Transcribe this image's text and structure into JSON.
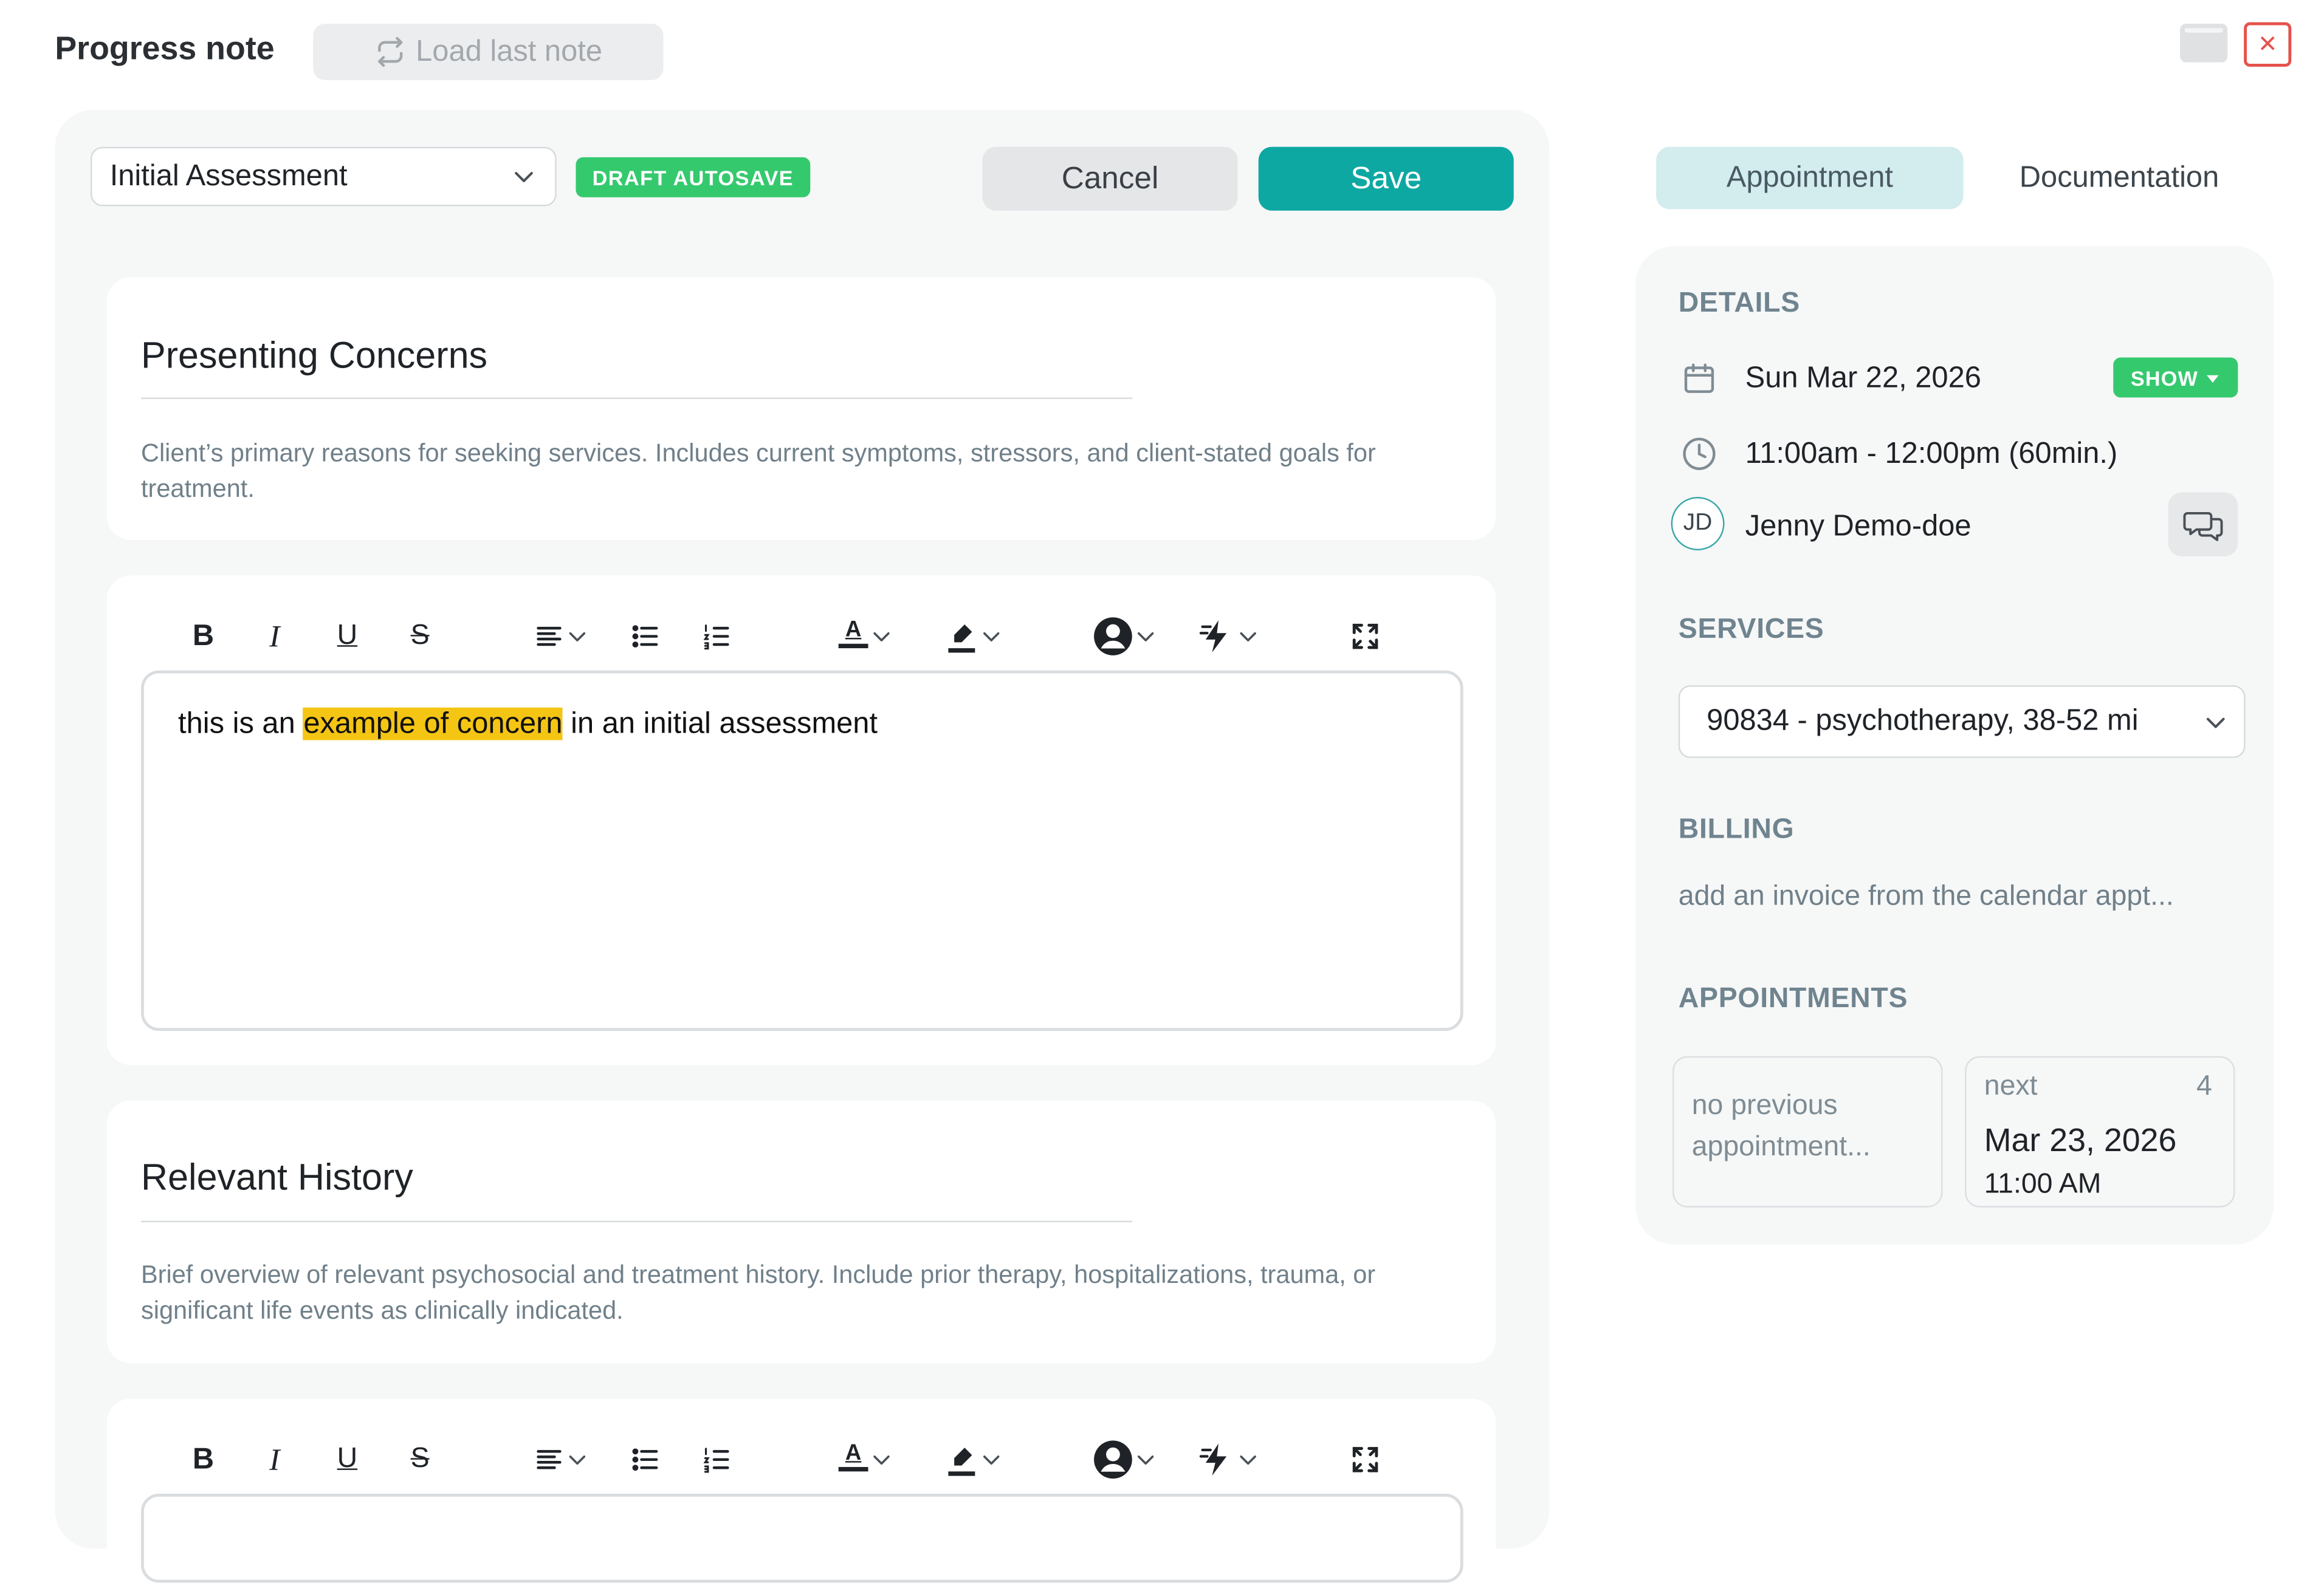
{
  "header": {
    "title": "Progress note",
    "load_last_note": "Load last note"
  },
  "window_controls": {
    "close_glyph": "✕"
  },
  "note": {
    "template_value": "Initial Assessment",
    "draft_badge": "DRAFT AUTOSAVE",
    "cancel_label": "Cancel",
    "save_label": "Save",
    "sections": [
      {
        "title": "Presenting Concerns",
        "description": "Client’s primary reasons for seeking services. Includes current symptoms, stressors, and client-stated goals for treatment.",
        "editor": {
          "text_before": "this is an ",
          "text_highlight": "example of concern",
          "text_after": " in an initial assessment"
        }
      },
      {
        "title": "Relevant History",
        "description": "Brief overview of relevant psychosocial and treatment history. Include prior therapy, hospitalizations, trauma, or significant life events as clinically indicated."
      }
    ],
    "toolbar": {
      "bold": "B",
      "italic": "I",
      "underline": "U",
      "strike": "S",
      "text_color": "A",
      "icons": [
        "align-left-icon",
        "bulleted-list-icon",
        "numbered-list-icon",
        "text-color-icon",
        "highlighter-icon",
        "user-icon",
        "lightning-icon",
        "fullscreen-icon"
      ]
    }
  },
  "sidebar": {
    "tabs": [
      {
        "label": "Appointment",
        "active": true
      },
      {
        "label": "Documentation",
        "active": false
      }
    ],
    "details": {
      "heading": "DETAILS",
      "date": "Sun Mar 22, 2026",
      "show_badge": "SHOW",
      "time": "11:00am - 12:00pm (60min.)",
      "client_initials": "JD",
      "client_name": "Jenny Demo-doe"
    },
    "services": {
      "heading": "SERVICES",
      "selected": "90834 - psychotherapy, 38-52 mi"
    },
    "billing": {
      "heading": "BILLING",
      "text": "add an invoice from the calendar appt..."
    },
    "appointments": {
      "heading": "APPOINTMENTS",
      "previous": "no previous appointment...",
      "next_label": "next",
      "next_count": "4",
      "next_date": "Mar 23, 2026",
      "next_time": "11:00 AM"
    }
  },
  "colors": {
    "accent": "#0ea8a3",
    "badge_green": "#35c96e",
    "highlight": "#f5c514",
    "panel_bg": "#f6f7f7",
    "close_red": "#e5534b"
  }
}
